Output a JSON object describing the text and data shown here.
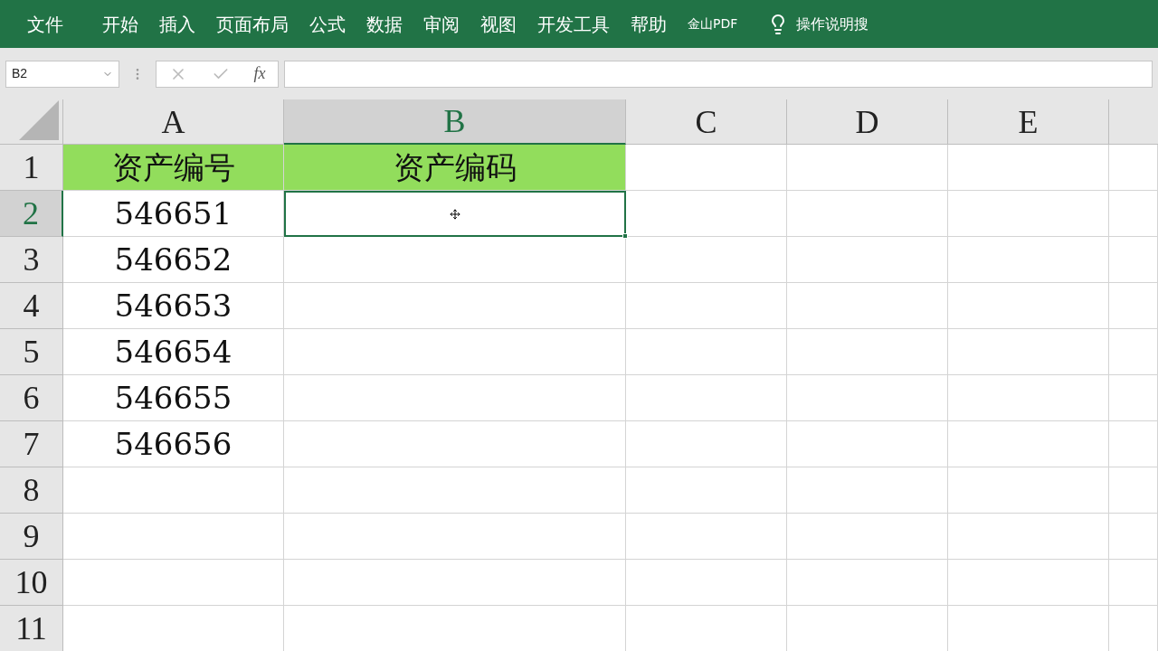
{
  "ribbon": {
    "tabs": [
      {
        "label": "文件",
        "selected": false
      },
      {
        "label": "开始",
        "selected": false
      },
      {
        "label": "插入",
        "selected": false
      },
      {
        "label": "页面布局",
        "selected": false
      },
      {
        "label": "公式",
        "selected": false
      },
      {
        "label": "数据",
        "selected": false
      },
      {
        "label": "审阅",
        "selected": false
      },
      {
        "label": "视图",
        "selected": false
      },
      {
        "label": "开发工具",
        "selected": false
      },
      {
        "label": "帮助",
        "selected": false
      },
      {
        "label": "金山PDF",
        "selected": false
      }
    ],
    "tell_me": "操作说明搜"
  },
  "formula_bar": {
    "name_box": "B2",
    "function_label": "fx"
  },
  "sheet": {
    "columns": [
      {
        "label": "A",
        "selected": false
      },
      {
        "label": "B",
        "selected": true
      },
      {
        "label": "C",
        "selected": false
      },
      {
        "label": "D",
        "selected": false
      },
      {
        "label": "E",
        "selected": false
      }
    ],
    "rows": [
      {
        "label": "1",
        "selected": false,
        "header": true,
        "cells": [
          "资产编号",
          "资产编码"
        ]
      },
      {
        "label": "2",
        "selected": true,
        "header": false,
        "cells": [
          "546651",
          ""
        ]
      },
      {
        "label": "3",
        "selected": false,
        "header": false,
        "cells": [
          "546652"
        ]
      },
      {
        "label": "4",
        "selected": false,
        "header": false,
        "cells": [
          "546653"
        ]
      },
      {
        "label": "5",
        "selected": false,
        "header": false,
        "cells": [
          "546654"
        ]
      },
      {
        "label": "6",
        "selected": false,
        "header": false,
        "cells": [
          "546655"
        ]
      },
      {
        "label": "7",
        "selected": false,
        "header": false,
        "cells": [
          "546656"
        ]
      },
      {
        "label": "8",
        "selected": false,
        "header": false,
        "cells": []
      },
      {
        "label": "9",
        "selected": false,
        "header": false,
        "cells": []
      },
      {
        "label": "10",
        "selected": false,
        "header": false,
        "cells": []
      },
      {
        "label": "11",
        "selected": false,
        "header": false,
        "cells": []
      }
    ]
  }
}
